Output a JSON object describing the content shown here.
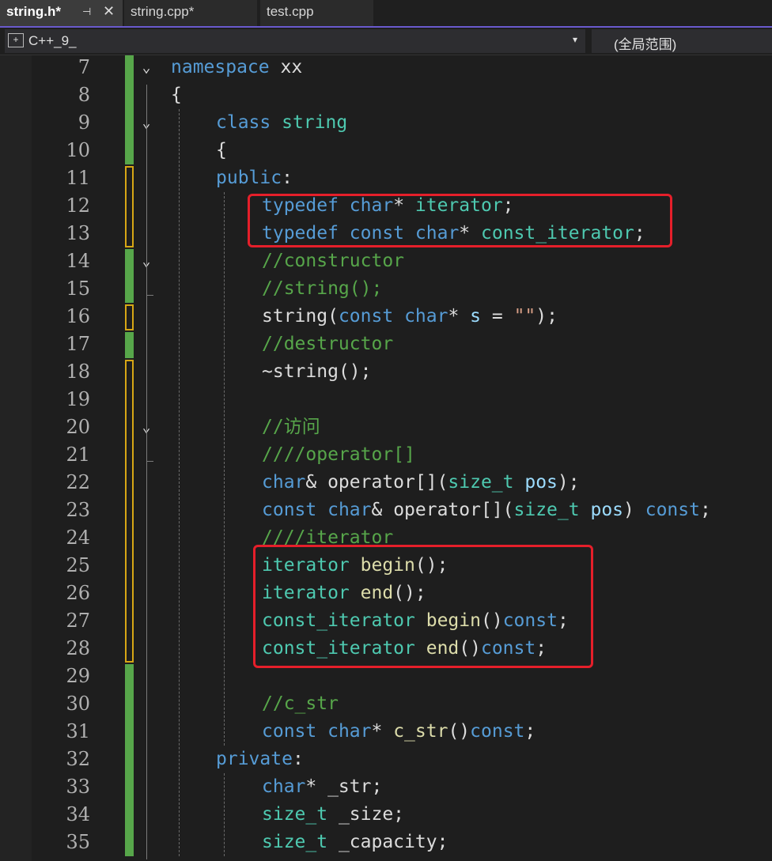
{
  "tabs": [
    {
      "label": "string.h*",
      "active": true
    },
    {
      "label": "string.cpp*",
      "active": false
    },
    {
      "label": "test.cpp",
      "active": false
    }
  ],
  "tab_icons": {
    "pin": "⊣",
    "close": "✕"
  },
  "navbar": {
    "file_scope": "C++_9_",
    "global_scope": "(全局范围)"
  },
  "colors": {
    "keyword": "#569cd6",
    "type": "#4ec9b0",
    "function": "#dcdcaa",
    "comment": "#57a64a",
    "param": "#9cdcfe",
    "string": "#d69d85",
    "highlight_box": "#e51f2a"
  },
  "code": [
    {
      "n": "7",
      "indent": 0,
      "toks": [
        [
          "namespace",
          "k"
        ],
        [
          " xx",
          ""
        ]
      ]
    },
    {
      "n": "8",
      "indent": 0,
      "toks": [
        [
          "{",
          ""
        ]
      ]
    },
    {
      "n": "9",
      "indent": 1,
      "toks": [
        [
          "class",
          "k"
        ],
        [
          " ",
          ""
        ],
        [
          "string",
          "t"
        ]
      ]
    },
    {
      "n": "10",
      "indent": 1,
      "toks": [
        [
          "{",
          ""
        ]
      ]
    },
    {
      "n": "11",
      "indent": 1,
      "toks": [
        [
          "public",
          "k"
        ],
        [
          ":",
          ""
        ]
      ]
    },
    {
      "n": "12",
      "indent": 2,
      "toks": [
        [
          "typedef",
          "k"
        ],
        [
          " ",
          ""
        ],
        [
          "char",
          "k"
        ],
        [
          "* ",
          ""
        ],
        [
          "iterator",
          "t"
        ],
        [
          ";",
          ""
        ]
      ]
    },
    {
      "n": "13",
      "indent": 2,
      "toks": [
        [
          "typedef",
          "k"
        ],
        [
          " ",
          ""
        ],
        [
          "const",
          "k"
        ],
        [
          " ",
          ""
        ],
        [
          "char",
          "k"
        ],
        [
          "* ",
          ""
        ],
        [
          "const_iterator",
          "t"
        ],
        [
          ";",
          ""
        ]
      ]
    },
    {
      "n": "14",
      "indent": 2,
      "toks": [
        [
          "//constructor",
          "c"
        ]
      ]
    },
    {
      "n": "15",
      "indent": 2,
      "toks": [
        [
          "//string();",
          "c"
        ]
      ]
    },
    {
      "n": "16",
      "indent": 2,
      "toks": [
        [
          "string",
          ""
        ],
        [
          "(",
          ""
        ],
        [
          "const",
          "k"
        ],
        [
          " ",
          ""
        ],
        [
          "char",
          "k"
        ],
        [
          "* ",
          ""
        ],
        [
          "s",
          "v"
        ],
        [
          " = ",
          ""
        ],
        [
          "\"\"",
          "s"
        ],
        [
          ");",
          ""
        ]
      ]
    },
    {
      "n": "17",
      "indent": 2,
      "toks": [
        [
          "//destructor",
          "c"
        ]
      ]
    },
    {
      "n": "18",
      "indent": 2,
      "toks": [
        [
          "~string",
          ""
        ],
        [
          "();",
          ""
        ]
      ]
    },
    {
      "n": "19",
      "indent": 2,
      "toks": []
    },
    {
      "n": "20",
      "indent": 2,
      "toks": [
        [
          "//访问",
          "c"
        ]
      ]
    },
    {
      "n": "21",
      "indent": 2,
      "toks": [
        [
          "////operator[]",
          "c"
        ]
      ]
    },
    {
      "n": "22",
      "indent": 2,
      "toks": [
        [
          "char",
          "k"
        ],
        [
          "& operator[](",
          ""
        ],
        [
          "size_t",
          "t"
        ],
        [
          " ",
          ""
        ],
        [
          "pos",
          "v"
        ],
        [
          ");",
          ""
        ]
      ]
    },
    {
      "n": "23",
      "indent": 2,
      "toks": [
        [
          "const",
          "k"
        ],
        [
          " ",
          ""
        ],
        [
          "char",
          "k"
        ],
        [
          "& operator[](",
          ""
        ],
        [
          "size_t",
          "t"
        ],
        [
          " ",
          ""
        ],
        [
          "pos",
          "v"
        ],
        [
          ") ",
          ""
        ],
        [
          "const",
          "k"
        ],
        [
          ";",
          ""
        ]
      ]
    },
    {
      "n": "24",
      "indent": 2,
      "toks": [
        [
          "////iterator",
          "c"
        ]
      ]
    },
    {
      "n": "25",
      "indent": 2,
      "toks": [
        [
          "iterator",
          "t"
        ],
        [
          " ",
          ""
        ],
        [
          "begin",
          "f"
        ],
        [
          "();",
          ""
        ]
      ]
    },
    {
      "n": "26",
      "indent": 2,
      "toks": [
        [
          "iterator",
          "t"
        ],
        [
          " ",
          ""
        ],
        [
          "end",
          "f"
        ],
        [
          "();",
          ""
        ]
      ]
    },
    {
      "n": "27",
      "indent": 2,
      "toks": [
        [
          "const_iterator",
          "t"
        ],
        [
          " ",
          ""
        ],
        [
          "begin",
          "f"
        ],
        [
          "()",
          ""
        ],
        [
          "const",
          "k"
        ],
        [
          ";",
          ""
        ]
      ]
    },
    {
      "n": "28",
      "indent": 2,
      "toks": [
        [
          "const_iterator",
          "t"
        ],
        [
          " ",
          ""
        ],
        [
          "end",
          "f"
        ],
        [
          "()",
          ""
        ],
        [
          "const",
          "k"
        ],
        [
          ";",
          ""
        ]
      ]
    },
    {
      "n": "29",
      "indent": 2,
      "toks": []
    },
    {
      "n": "30",
      "indent": 2,
      "toks": [
        [
          "//c_str",
          "c"
        ]
      ]
    },
    {
      "n": "31",
      "indent": 2,
      "toks": [
        [
          "const",
          "k"
        ],
        [
          " ",
          ""
        ],
        [
          "char",
          "k"
        ],
        [
          "* ",
          ""
        ],
        [
          "c_str",
          "f"
        ],
        [
          "()",
          ""
        ],
        [
          "const",
          "k"
        ],
        [
          ";",
          ""
        ]
      ]
    },
    {
      "n": "32",
      "indent": 1,
      "toks": [
        [
          "private",
          "k"
        ],
        [
          ":",
          ""
        ]
      ]
    },
    {
      "n": "33",
      "indent": 2,
      "toks": [
        [
          "char",
          "k"
        ],
        [
          "* _str;",
          ""
        ]
      ]
    },
    {
      "n": "34",
      "indent": 2,
      "toks": [
        [
          "size_t",
          "t"
        ],
        [
          " _size;",
          ""
        ]
      ]
    },
    {
      "n": "35",
      "indent": 2,
      "toks": [
        [
          "size_t",
          "t"
        ],
        [
          " _capacity;",
          ""
        ]
      ]
    }
  ]
}
